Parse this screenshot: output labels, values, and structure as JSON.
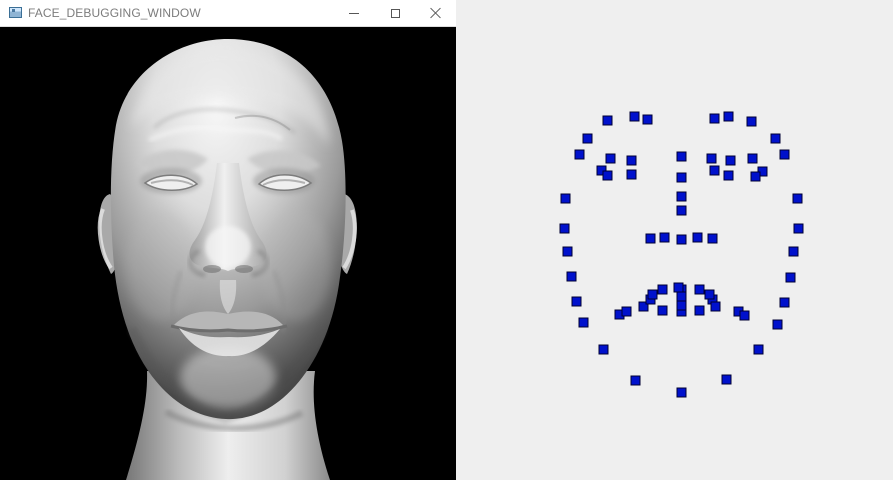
{
  "window": {
    "title": "FACE_DEBUGGING_WINDOW",
    "controls": [
      "minimize",
      "maximize",
      "close"
    ]
  },
  "icons": {
    "app": "window-app-icon",
    "minimize": "minimize-icon",
    "maximize": "maximize-icon",
    "close": "close-icon"
  },
  "colors": {
    "viewport_background": "#000000",
    "debug_background": "#efefef",
    "landmark_fill": "#0011cc",
    "landmark_stroke": "#000033"
  },
  "scene": {
    "subject": "rendered 3D face"
  },
  "landmarks": {
    "count": 68,
    "marker_shape": "square"
  }
}
